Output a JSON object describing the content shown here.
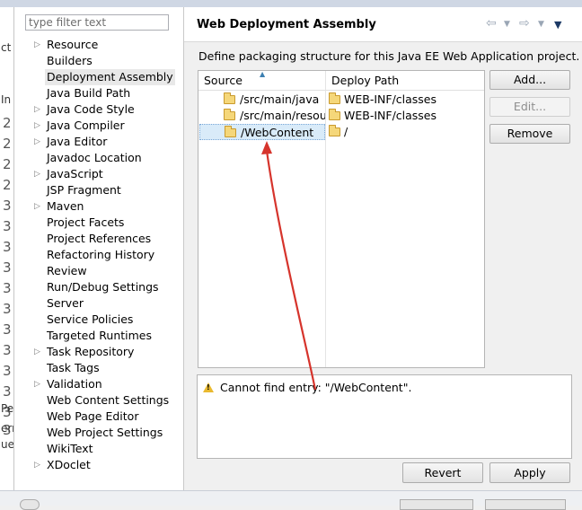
{
  "background_window": {
    "fragments": [
      "ct",
      "In",
      "2",
      "2",
      "2",
      "2",
      "3",
      "3",
      "3",
      "3",
      "3",
      "3",
      "3",
      "3",
      "3",
      "3",
      "3",
      "3",
      "Pe",
      "ern",
      "ue"
    ]
  },
  "tree": {
    "filter_placeholder": "type filter text",
    "items": [
      {
        "label": "Resource",
        "expandable": true
      },
      {
        "label": "Builders",
        "expandable": false
      },
      {
        "label": "Deployment Assembly",
        "expandable": false,
        "selected": true
      },
      {
        "label": "Java Build Path",
        "expandable": false
      },
      {
        "label": "Java Code Style",
        "expandable": true
      },
      {
        "label": "Java Compiler",
        "expandable": true
      },
      {
        "label": "Java Editor",
        "expandable": true
      },
      {
        "label": "Javadoc Location",
        "expandable": false
      },
      {
        "label": "JavaScript",
        "expandable": true
      },
      {
        "label": "JSP Fragment",
        "expandable": false
      },
      {
        "label": "Maven",
        "expandable": true
      },
      {
        "label": "Project Facets",
        "expandable": false
      },
      {
        "label": "Project References",
        "expandable": false
      },
      {
        "label": "Refactoring History",
        "expandable": false
      },
      {
        "label": "Review",
        "expandable": false
      },
      {
        "label": "Run/Debug Settings",
        "expandable": false
      },
      {
        "label": "Server",
        "expandable": false
      },
      {
        "label": "Service Policies",
        "expandable": false
      },
      {
        "label": "Targeted Runtimes",
        "expandable": false
      },
      {
        "label": "Task Repository",
        "expandable": true
      },
      {
        "label": "Task Tags",
        "expandable": false
      },
      {
        "label": "Validation",
        "expandable": true
      },
      {
        "label": "Web Content Settings",
        "expandable": false
      },
      {
        "label": "Web Page Editor",
        "expandable": false
      },
      {
        "label": "Web Project Settings",
        "expandable": false
      },
      {
        "label": "WikiText",
        "expandable": false
      },
      {
        "label": "XDoclet",
        "expandable": true
      }
    ]
  },
  "header": {
    "title": "Web Deployment Assembly",
    "icons": [
      "back-arrow-icon",
      "back-dropdown-icon",
      "forward-arrow-icon",
      "forward-dropdown-icon",
      "view-menu-icon"
    ]
  },
  "main": {
    "description": "Define packaging structure for this Java EE Web Application project.",
    "table": {
      "columns": [
        "Source",
        "Deploy Path"
      ],
      "rows": [
        {
          "source": "/src/main/java",
          "deploy_path": "WEB-INF/classes"
        },
        {
          "source": "/src/main/resources",
          "deploy_path": "WEB-INF/classes"
        },
        {
          "source": "/WebContent",
          "deploy_path": "/",
          "selected": true
        }
      ]
    },
    "buttons": {
      "add": "Add...",
      "edit": "Edit...",
      "remove": "Remove"
    },
    "message": "Cannot find entry: \"/WebContent\".",
    "footer_buttons": {
      "revert": "Revert",
      "apply": "Apply"
    }
  },
  "colors": {
    "annotation_arrow": "#d6342c",
    "selection": "#d9ebf9",
    "warning": "#e9b92f"
  }
}
